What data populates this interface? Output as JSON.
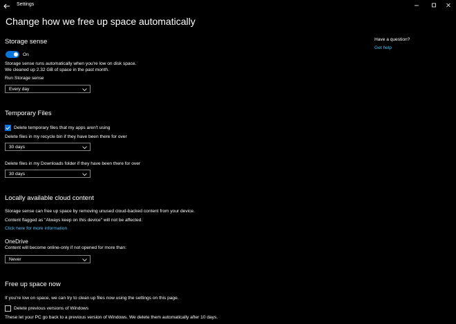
{
  "app": {
    "title": "Settings"
  },
  "page_title": "Change how we free up space automatically",
  "sidebar": {
    "question": "Have a question?",
    "help_link": "Get help"
  },
  "storage_sense": {
    "heading": "Storage sense",
    "toggle_state": "On",
    "description_1": "Storage sense runs automatically when you're low on disk space.",
    "description_2": "We cleaned up 2.32 GB of space in the past month.",
    "run_label": "Run Storage sense",
    "run_value": "Every day"
  },
  "temporary_files": {
    "heading": "Temporary Files",
    "delete_temp_label": "Delete temporary files that my apps aren't using",
    "delete_temp_checked": true,
    "recycle_label": "Delete files in my recycle bin if they have been there for over",
    "recycle_value": "30 days",
    "downloads_label": "Delete files in my Downloads folder if they have been there for over",
    "downloads_value": "30 days"
  },
  "cloud_content": {
    "heading": "Locally available cloud content",
    "description_1": "Storage sense can free up space by removing unused cloud-backed content from your device.",
    "description_2": "Content flagged as \"Always keep on this device\" will not be affected.",
    "more_info_link": "Click here for more information",
    "onedrive_heading": "OneDrive",
    "onedrive_label": "Content will become online-only if not opened for more than:",
    "onedrive_value": "Never"
  },
  "free_up_now": {
    "heading": "Free up space now",
    "description": "If you're low on space, we can try to clean up files now using the settings on this page.",
    "delete_previous_label": "Delete previous versions of Windows",
    "delete_previous_checked": false,
    "footer": "These let your PC go back to a previous version of Windows. We delete them automatically after 10 days."
  },
  "colors": {
    "accent": "#0a74da",
    "link": "#4cc2ff",
    "background": "#000000"
  }
}
